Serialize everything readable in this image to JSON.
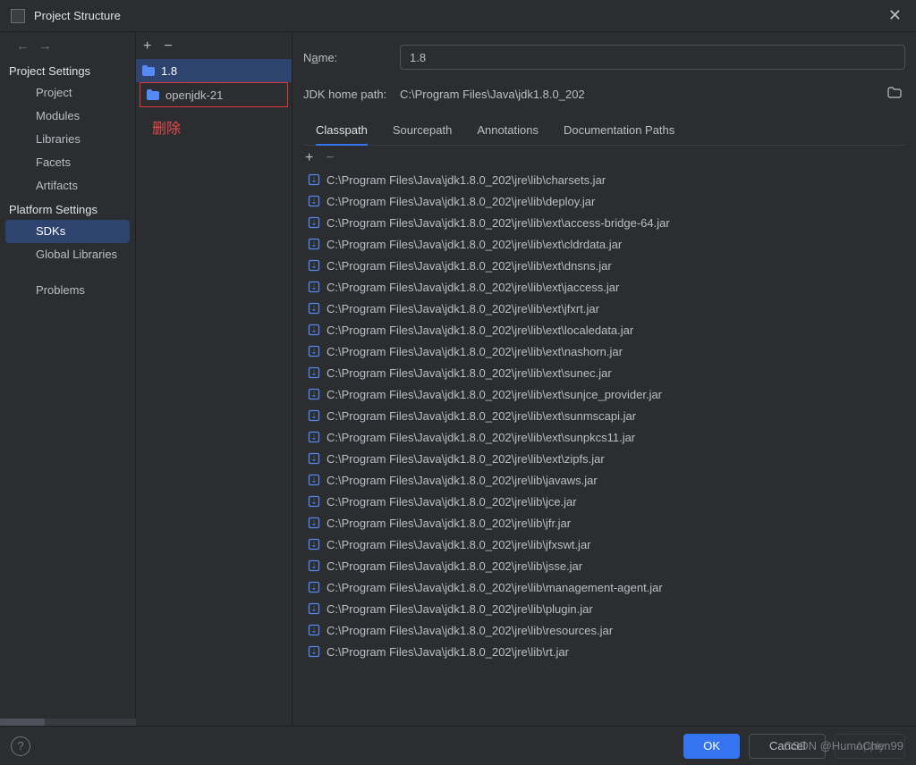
{
  "title": "Project Structure",
  "nav": {
    "project_settings_header": "Project Settings",
    "platform_settings_header": "Platform Settings",
    "project": "Project",
    "modules": "Modules",
    "libraries": "Libraries",
    "facets": "Facets",
    "artifacts": "Artifacts",
    "sdks": "SDKs",
    "global_libraries": "Global Libraries",
    "problems": "Problems"
  },
  "list": {
    "add": "+",
    "remove": "−",
    "items": [
      {
        "label": "1.8",
        "selected": true
      },
      {
        "label": "openjdk-21",
        "selected": false
      }
    ]
  },
  "annotation": {
    "delete": "删除"
  },
  "detail": {
    "name_label_pre": "N",
    "name_label_u": "a",
    "name_label_post": "me:",
    "name_value": "1.8",
    "home_label": "JDK home path:",
    "home_value": "C:\\Program Files\\Java\\jdk1.8.0_202"
  },
  "tabs": {
    "classpath": "Classpath",
    "sourcepath": "Sourcepath",
    "annotations": "Annotations",
    "documentation": "Documentation Paths"
  },
  "classpath": [
    "C:\\Program Files\\Java\\jdk1.8.0_202\\jre\\lib\\charsets.jar",
    "C:\\Program Files\\Java\\jdk1.8.0_202\\jre\\lib\\deploy.jar",
    "C:\\Program Files\\Java\\jdk1.8.0_202\\jre\\lib\\ext\\access-bridge-64.jar",
    "C:\\Program Files\\Java\\jdk1.8.0_202\\jre\\lib\\ext\\cldrdata.jar",
    "C:\\Program Files\\Java\\jdk1.8.0_202\\jre\\lib\\ext\\dnsns.jar",
    "C:\\Program Files\\Java\\jdk1.8.0_202\\jre\\lib\\ext\\jaccess.jar",
    "C:\\Program Files\\Java\\jdk1.8.0_202\\jre\\lib\\ext\\jfxrt.jar",
    "C:\\Program Files\\Java\\jdk1.8.0_202\\jre\\lib\\ext\\localedata.jar",
    "C:\\Program Files\\Java\\jdk1.8.0_202\\jre\\lib\\ext\\nashorn.jar",
    "C:\\Program Files\\Java\\jdk1.8.0_202\\jre\\lib\\ext\\sunec.jar",
    "C:\\Program Files\\Java\\jdk1.8.0_202\\jre\\lib\\ext\\sunjce_provider.jar",
    "C:\\Program Files\\Java\\jdk1.8.0_202\\jre\\lib\\ext\\sunmscapi.jar",
    "C:\\Program Files\\Java\\jdk1.8.0_202\\jre\\lib\\ext\\sunpkcs11.jar",
    "C:\\Program Files\\Java\\jdk1.8.0_202\\jre\\lib\\ext\\zipfs.jar",
    "C:\\Program Files\\Java\\jdk1.8.0_202\\jre\\lib\\javaws.jar",
    "C:\\Program Files\\Java\\jdk1.8.0_202\\jre\\lib\\jce.jar",
    "C:\\Program Files\\Java\\jdk1.8.0_202\\jre\\lib\\jfr.jar",
    "C:\\Program Files\\Java\\jdk1.8.0_202\\jre\\lib\\jfxswt.jar",
    "C:\\Program Files\\Java\\jdk1.8.0_202\\jre\\lib\\jsse.jar",
    "C:\\Program Files\\Java\\jdk1.8.0_202\\jre\\lib\\management-agent.jar",
    "C:\\Program Files\\Java\\jdk1.8.0_202\\jre\\lib\\plugin.jar",
    "C:\\Program Files\\Java\\jdk1.8.0_202\\jre\\lib\\resources.jar",
    "C:\\Program Files\\Java\\jdk1.8.0_202\\jre\\lib\\rt.jar"
  ],
  "footer": {
    "ok": "OK",
    "cancel": "Cancel",
    "apply": "Apply"
  },
  "watermark": "CSDN @HumoChen99"
}
